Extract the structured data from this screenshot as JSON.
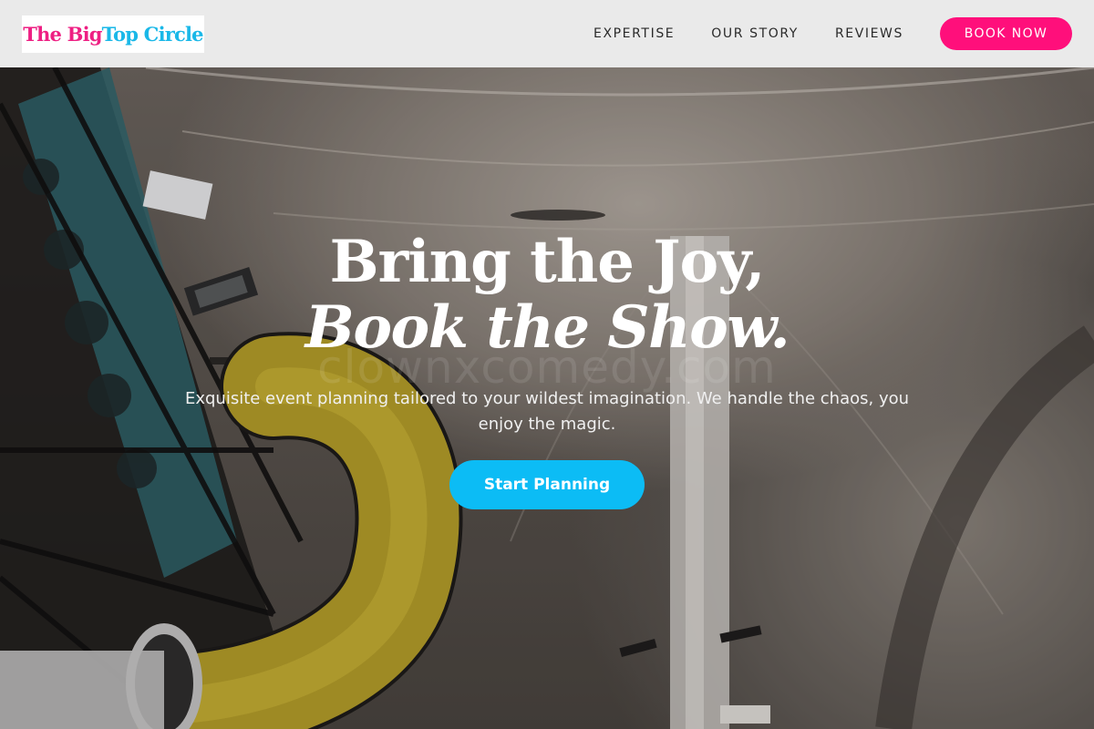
{
  "header": {
    "logo": {
      "part1": "The Big ",
      "part2": "Top Circle"
    },
    "nav": [
      {
        "label": "EXPERTISE"
      },
      {
        "label": "OUR STORY"
      },
      {
        "label": "REVIEWS"
      }
    ],
    "book_label": "BOOK NOW"
  },
  "hero": {
    "headline_line1": "Bring the Joy,",
    "headline_line2": "Book the Show.",
    "subtitle": "Exquisite event planning tailored to your wildest imagination. We handle the chaos, you enjoy the magic.",
    "cta_label": "Start Planning",
    "watermark": "clownxcomedy.com"
  },
  "colors": {
    "brand_pink": "#ff0f7b",
    "brand_cyan": "#0cbcf5",
    "header_bg": "#eaeaea"
  }
}
